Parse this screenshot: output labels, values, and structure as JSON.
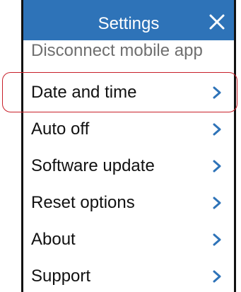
{
  "header": {
    "title": "Settings",
    "close_icon": "close-icon",
    "background_color": "#2e73b8"
  },
  "menu": {
    "partial_item_label": "Disconnect mobile app",
    "items": [
      {
        "label": "Date and time",
        "icon": "chevron-right-icon",
        "highlighted": true
      },
      {
        "label": "Auto off",
        "icon": "chevron-right-icon"
      },
      {
        "label": "Software update",
        "icon": "chevron-right-icon"
      },
      {
        "label": "Reset options",
        "icon": "chevron-right-icon"
      },
      {
        "label": "About",
        "icon": "chevron-right-icon"
      },
      {
        "label": "Support",
        "icon": "chevron-right-icon"
      }
    ]
  },
  "colors": {
    "accent": "#2e73b8",
    "highlight_outline": "#c8202a"
  }
}
